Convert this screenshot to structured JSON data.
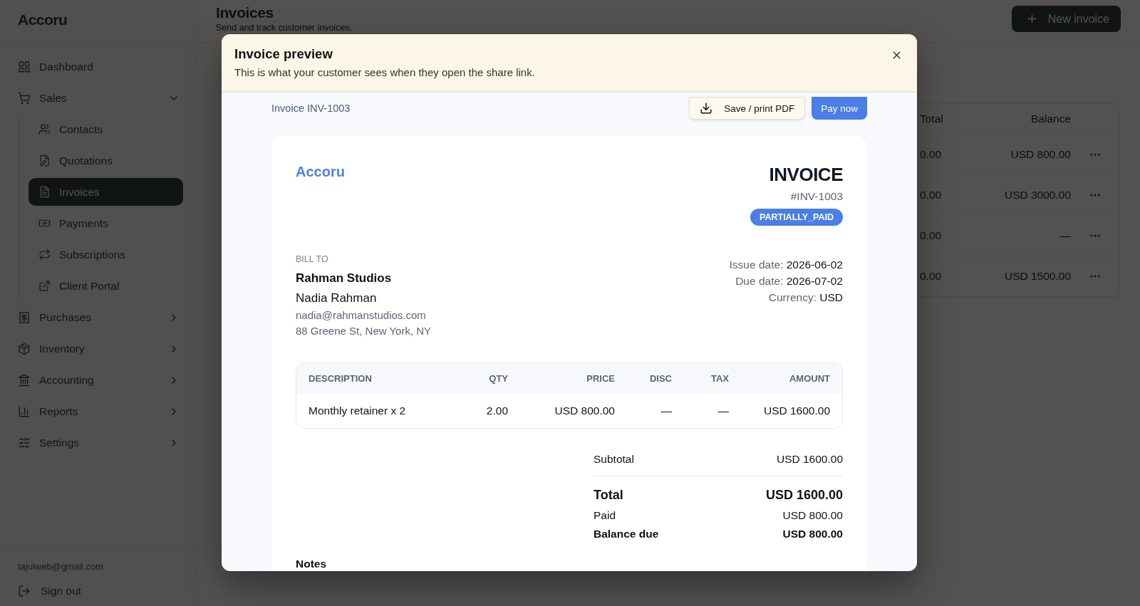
{
  "app": {
    "logo": "Accoru"
  },
  "sidebar": {
    "items": [
      {
        "label": "Dashboard",
        "selected": false
      },
      {
        "label": "Sales",
        "selected": false,
        "expanded": true,
        "children": [
          {
            "label": "Contacts",
            "selected": false
          },
          {
            "label": "Quotations",
            "selected": false
          },
          {
            "label": "Invoices",
            "selected": true
          },
          {
            "label": "Payments",
            "selected": false
          },
          {
            "label": "Subscriptions",
            "selected": false
          },
          {
            "label": "Client Portal",
            "selected": false
          }
        ]
      },
      {
        "label": "Purchases",
        "selected": false,
        "expanded": false
      },
      {
        "label": "Inventory",
        "selected": false,
        "expanded": false
      },
      {
        "label": "Accounting",
        "selected": false,
        "expanded": false
      },
      {
        "label": "Reports",
        "selected": false,
        "expanded": false
      },
      {
        "label": "Settings",
        "selected": false,
        "expanded": false
      }
    ],
    "user_email": "tajulweb@gmail.com",
    "sign_out": "Sign out"
  },
  "page": {
    "title": "Invoices",
    "subtitle": "Send and track customer invoices.",
    "new_button": "New invoice"
  },
  "invoice_table": {
    "columns": [
      "Total",
      "Balance"
    ],
    "rows": [
      {
        "total": "0.00",
        "balance": "USD 800.00"
      },
      {
        "total": "0.00",
        "balance": "USD 3000.00"
      },
      {
        "total": "0.00",
        "balance": "—"
      },
      {
        "total": "0.00",
        "balance": "USD 1500.00"
      }
    ]
  },
  "modal": {
    "title": "Invoice preview",
    "subtitle": "This is what your customer sees when they open the share link.",
    "reference": "Invoice INV-1003",
    "save_button": "Save / print PDF",
    "pay_button": "Pay now",
    "invoice": {
      "brand": "Accoru",
      "heading": "INVOICE",
      "number": "#INV-1003",
      "status": "PARTIALLY_PAID",
      "bill_to_label": "BILL TO",
      "company": "Rahman Studios",
      "contact": "Nadia Rahman",
      "email": "nadia@rahmanstudios.com",
      "address": "88 Greene St, New York, NY",
      "meta": [
        {
          "label": "Issue date:",
          "value": "2026-06-02"
        },
        {
          "label": "Due date:",
          "value": "2026-07-02"
        },
        {
          "label": "Currency:",
          "value": "USD"
        }
      ],
      "lines": {
        "columns": [
          "DESCRIPTION",
          "QTY",
          "PRICE",
          "DISC",
          "TAX",
          "AMOUNT"
        ],
        "rows": [
          [
            "Monthly retainer x 2",
            "2.00",
            "USD 800.00",
            "—",
            "—",
            "USD 1600.00"
          ]
        ]
      },
      "totals": [
        {
          "label": "Subtotal",
          "value": "USD 1600.00",
          "kind": "normal"
        },
        {
          "label": "Total",
          "value": "USD 1600.00",
          "kind": "grand"
        },
        {
          "label": "Paid",
          "value": "USD 800.00",
          "kind": "normal"
        },
        {
          "label": "Balance due",
          "value": "USD 800.00",
          "kind": "strong"
        }
      ],
      "notes_label": "Notes"
    }
  }
}
